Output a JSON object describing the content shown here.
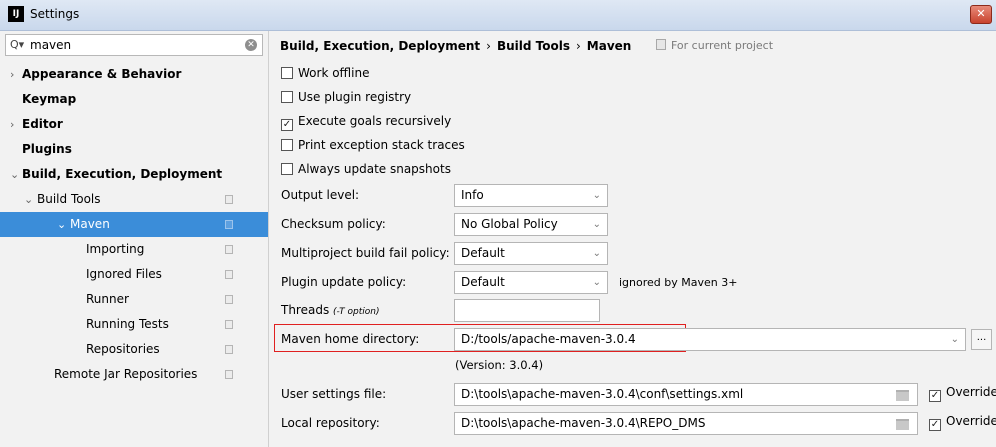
{
  "window": {
    "title": "Settings",
    "app_icon": "IJ",
    "close_glyph": "✕"
  },
  "search": {
    "value": "maven",
    "placeholder": ""
  },
  "tree": [
    {
      "label": "Appearance & Behavior",
      "arrow": "›",
      "bold": true
    },
    {
      "label": "Keymap",
      "arrow": "",
      "bold": true
    },
    {
      "label": "Editor",
      "arrow": "›",
      "bold": true
    },
    {
      "label": "Plugins",
      "arrow": "",
      "bold": true
    },
    {
      "label": "Build, Execution, Deployment",
      "arrow": "⌄",
      "bold": true
    },
    {
      "label": "Build Tools",
      "arrow": "⌄",
      "bold": false
    },
    {
      "label": "Maven",
      "arrow": "⌄",
      "bold": false
    },
    {
      "label": "Importing",
      "arrow": "",
      "bold": false
    },
    {
      "label": "Ignored Files",
      "arrow": "",
      "bold": false
    },
    {
      "label": "Runner",
      "arrow": "",
      "bold": false
    },
    {
      "label": "Running Tests",
      "arrow": "",
      "bold": false
    },
    {
      "label": "Repositories",
      "arrow": "",
      "bold": false
    },
    {
      "label": "Remote Jar Repositories",
      "arrow": "",
      "bold": false
    }
  ],
  "breadcrumb": {
    "part1": "Build, Execution, Deployment",
    "part2": "Build Tools",
    "part3": "Maven",
    "separator": "›",
    "project_note": "For current project"
  },
  "checkboxes": [
    {
      "label": "Work offline",
      "checked": false
    },
    {
      "label": "Use plugin registry",
      "checked": false
    },
    {
      "label": "Execute goals recursively",
      "checked": true
    },
    {
      "label": "Print exception stack traces",
      "checked": false
    },
    {
      "label": "Always update snapshots",
      "checked": false
    }
  ],
  "fields": {
    "output_level": {
      "label": "Output level:",
      "value": "Info"
    },
    "checksum": {
      "label": "Checksum policy:",
      "value": "No Global Policy"
    },
    "multiproject": {
      "label": "Multiproject build fail policy:",
      "value": "Default"
    },
    "plugin_update": {
      "label": "Plugin update policy:",
      "value": "Default",
      "note": "ignored by Maven 3+"
    },
    "threads": {
      "label": "Threads",
      "hint": "(-T option)",
      "value": ""
    },
    "maven_home": {
      "label": "Maven home directory:",
      "value": "D:/tools/apache-maven-3.0.4",
      "version": "(Version: 3.0.4)",
      "browse": "..."
    },
    "user_settings": {
      "label": "User settings file:",
      "value": "D:\\tools\\apache-maven-3.0.4\\conf\\settings.xml",
      "override": "Override",
      "override_checked": true
    },
    "local_repo": {
      "label": "Local repository:",
      "value": "D:\\tools\\apache-maven-3.0.4\\REPO_DMS",
      "override": "Override",
      "override_checked": true
    }
  },
  "colors": {
    "selection": "#3b8dd9",
    "highlight_box": "#e02020",
    "title_bar": "#c9d8ec"
  },
  "glyphs": {
    "caret": "⌄",
    "check": "✓"
  }
}
